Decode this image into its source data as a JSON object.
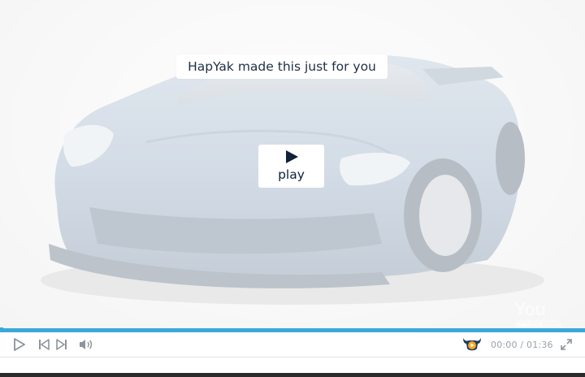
{
  "overlay": {
    "tagline": "HapYak made this just for you",
    "play_label": "play"
  },
  "watermark": {
    "text_a": "You",
    "text_b": "Tube"
  },
  "controls": {
    "current_time": "00:00",
    "separator": "/",
    "duration": "01:36",
    "progress_fraction": 0.0
  },
  "colors": {
    "accent": "#3aa9da",
    "text_dark": "#0e2238",
    "icon": "#8d949b"
  },
  "icons": [
    "play-icon",
    "previous-icon",
    "next-icon",
    "volume-icon",
    "hapyak-logo-icon",
    "fullscreen-icon"
  ]
}
